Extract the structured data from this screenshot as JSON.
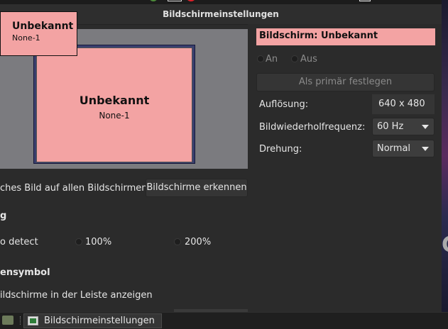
{
  "window": {
    "title": "Bildschirmeinstellungen"
  },
  "preview": {
    "monitor_name": "Unbekannt",
    "monitor_output": "None-1",
    "identify_popup_name": "Unbekannt",
    "identify_popup_output": "None-1",
    "monitor_color": "#f3a3a3"
  },
  "left_panel": {
    "mirror_label": "ches Bild auf allen Bildschirmen",
    "identify_button": "Bildschirme erkennen",
    "scaling_heading": "g",
    "scale_options": [
      "o detect",
      "100%",
      "200%"
    ],
    "tray_heading": "ensymbol",
    "tray_label": "ildschirme in der Leiste anzeigen"
  },
  "right_panel": {
    "header": "Bildschirm: Unbekannt",
    "radio_on": "An",
    "radio_off": "Aus",
    "primary_button": "Als primär festlegen",
    "resolution_label": "Auflösung:",
    "resolution_value": "640 x 480",
    "refresh_label": "Bildwiederholfrequenz:",
    "refresh_value": "60 Hz",
    "rotation_label": "Drehung:",
    "rotation_value": "Normal"
  },
  "taskbar": {
    "task_label": "Bildschirmeinstellungen"
  },
  "icons": [
    "folder-icon",
    "app-icon",
    "chevron-down-icon",
    "radio-icon"
  ]
}
